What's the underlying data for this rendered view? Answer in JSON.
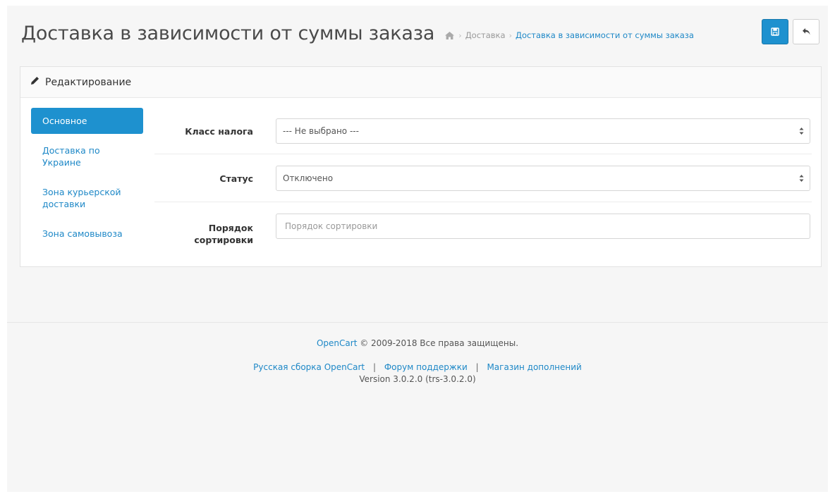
{
  "header": {
    "title": "Доставка в зависимости от суммы заказа",
    "breadcrumb": {
      "home_icon": "home-icon",
      "items": [
        "Доставка",
        "Доставка в зависимости от суммы заказа"
      ]
    },
    "buttons": {
      "save_icon": "save-icon",
      "back_icon": "reply-icon"
    }
  },
  "panel": {
    "heading_icon": "pencil-icon",
    "heading": "Редактирование",
    "tabs": [
      "Основное",
      "Доставка по Украине",
      "Зона курьерской доставки",
      "Зона самовывоза"
    ],
    "fields": {
      "tax_class": {
        "label": "Класс налога",
        "value": "--- Не выбрано ---"
      },
      "status": {
        "label": "Статус",
        "value": "Отключено"
      },
      "sort_order": {
        "label": "Порядок сортировки",
        "placeholder": "Порядок сортировки",
        "value": ""
      }
    }
  },
  "footer": {
    "brand": "OpenCart",
    "copyright": "© 2009-2018 Все права защищены.",
    "links": [
      "Русская сборка OpenCart",
      "Форум поддержки",
      "Магазин дополнений"
    ],
    "separator": "|",
    "version": "Version 3.0.2.0 (trs-3.0.2.0)"
  },
  "colors": {
    "accent": "#1e91cf",
    "link": "#1e88c7",
    "background": "#f6f6f6"
  }
}
